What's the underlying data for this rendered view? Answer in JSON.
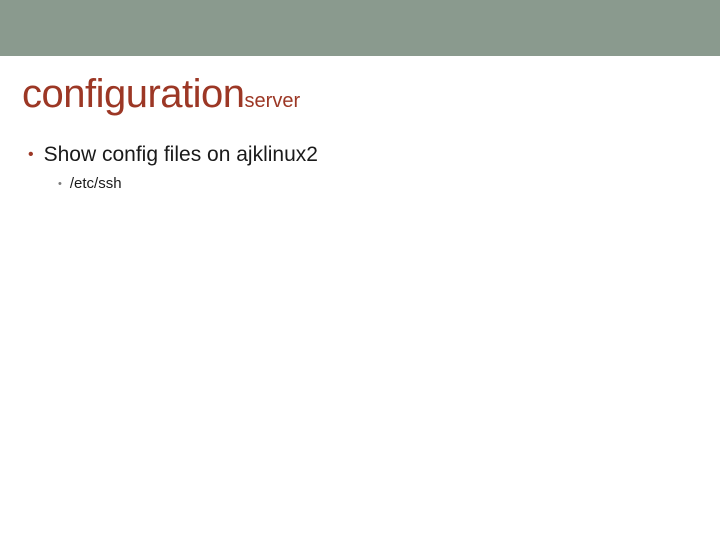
{
  "title": {
    "main": "configuration",
    "sub": "server"
  },
  "bullets": {
    "level1": "Show config files on ajklinux2",
    "level2": "/etc/ssh"
  }
}
